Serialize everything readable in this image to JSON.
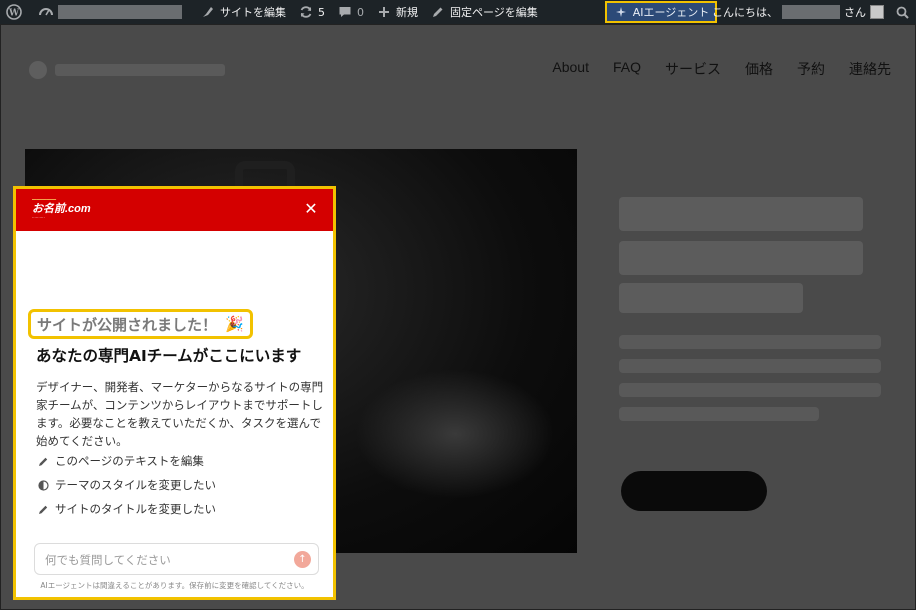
{
  "adminbar": {
    "edit_site": "サイトを編集",
    "updates_count": "5",
    "comments_count": "0",
    "new_label": "新規",
    "edit_page": "固定ページを編集",
    "ai_agent": "AIエージェント",
    "greeting": "こんにちは、",
    "greeting_suffix": "さん"
  },
  "site": {
    "nav": [
      "About",
      "FAQ",
      "サービス",
      "価格",
      "予約",
      "連絡先"
    ]
  },
  "panel": {
    "brand_name": "お名前.com",
    "published": "サイトが公開されました！",
    "heading": "あなたの専門AIチームがここにいます",
    "description": "デザイナー、開発者、マーケターからなるサイトの専門家チームが、コンテンツからレイアウトまでサポートします。必要なことを教えていただくか、タスクを選んで始めてください。",
    "suggestions": [
      {
        "icon": "pencil-icon",
        "label": "このページのテキストを編集"
      },
      {
        "icon": "half-circle-icon",
        "label": "テーマのスタイルを変更したい"
      },
      {
        "icon": "pencil-icon",
        "label": "サイトのタイトルを変更したい"
      }
    ],
    "input_placeholder": "何でも質問してください",
    "disclaimer": "AIエージェントは間違えることがあります。保存前に変更を確認してください。"
  },
  "colors": {
    "adminbar_bg": "#1d2327",
    "highlight": "#f2c200",
    "panel_header": "#d40000",
    "ai_button": "#2c4a78"
  }
}
